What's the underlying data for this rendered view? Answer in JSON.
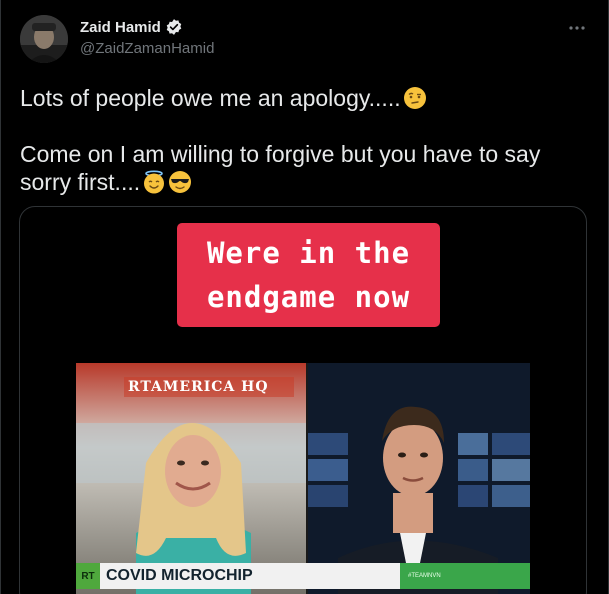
{
  "tweet": {
    "author": {
      "display_name": "Zaid Hamid",
      "handle": "@ZaidZamanHamid",
      "verified": true,
      "avatar_icon": "avatar-photo"
    },
    "more_icon": "more-options-icon",
    "text": {
      "line1": "Lots of people owe me an apology.....",
      "line1_emoji": "thinking-face-raised-eyebrow",
      "line2": "Come on I am willing to forgive but you have to say",
      "line3": "sorry first....",
      "line3_emojis": [
        "smiling-face-with-halo",
        "smiling-face-with-sunglasses"
      ]
    },
    "media": {
      "caption_line1": "Were in the",
      "caption_line2": "endgame now",
      "channel_label": "RTAMERICA HQ",
      "logo_text": "RT",
      "chyron_text": "COVID MICROCHIP",
      "chyron_tag": "#TEAMNVN"
    }
  },
  "colors": {
    "background": "#000000",
    "text_primary": "#e7e9ea",
    "text_secondary": "#71767b",
    "verified_blue": "#e7e9ea",
    "caption_red": "#e6304a",
    "rt_green": "#4fa83d"
  }
}
